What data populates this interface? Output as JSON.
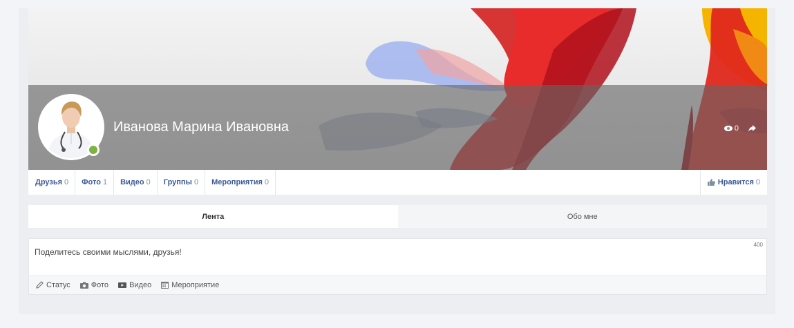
{
  "profile": {
    "name": "Иванова Марина Ивановна",
    "views": "0",
    "online_color": "#7cb342"
  },
  "nav": {
    "items": [
      {
        "label": "Друзья",
        "count": "0"
      },
      {
        "label": "Фото",
        "count": "1"
      },
      {
        "label": "Видео",
        "count": "0"
      },
      {
        "label": "Группы",
        "count": "0"
      },
      {
        "label": "Мероприятия",
        "count": "0"
      }
    ],
    "like": {
      "label": "Нравится",
      "count": "0"
    }
  },
  "tabs": [
    {
      "label": "Лента",
      "active": true
    },
    {
      "label": "Обо мне",
      "active": false
    }
  ],
  "composer": {
    "placeholder": "Поделитесь своими мыслями, друзья!",
    "char_limit": "400",
    "actions": [
      {
        "label": "Статус",
        "icon": "pencil-icon"
      },
      {
        "label": "Фото",
        "icon": "camera-icon"
      },
      {
        "label": "Видео",
        "icon": "video-icon"
      },
      {
        "label": "Мероприятие",
        "icon": "calendar-icon"
      }
    ]
  },
  "colors": {
    "link": "#3b5998",
    "count": "#7f8fa4",
    "cover_band": "#646464"
  }
}
